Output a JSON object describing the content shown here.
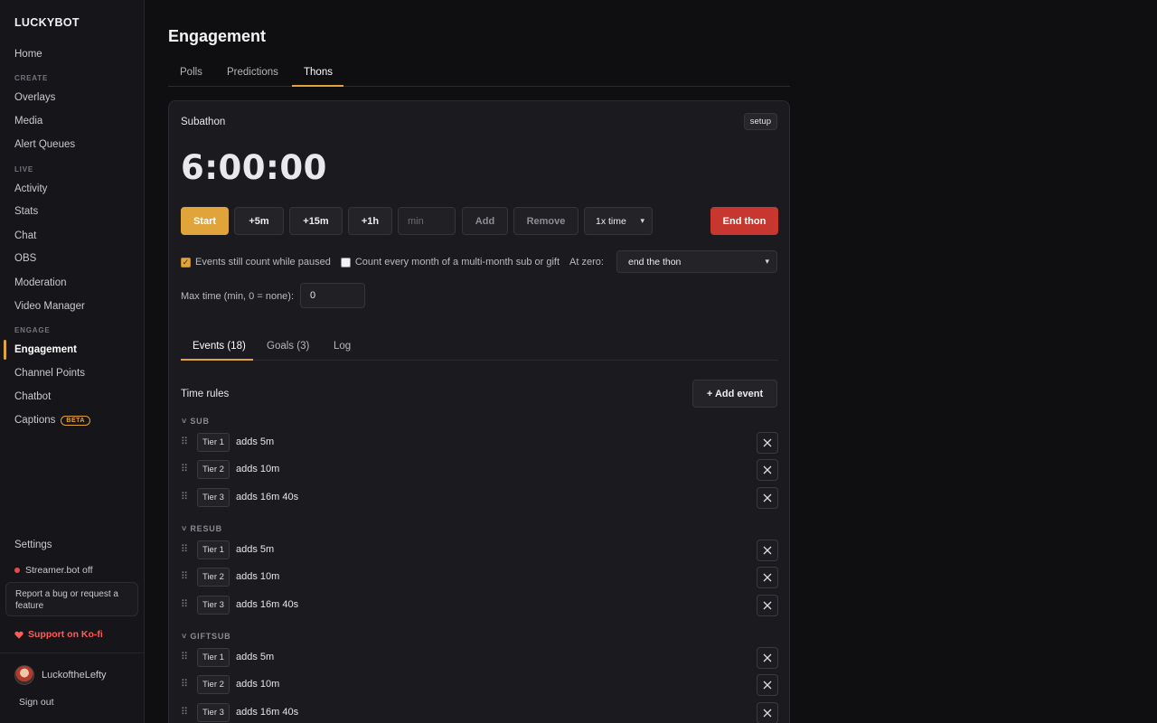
{
  "sidebar": {
    "brand": "LUCKYBOT",
    "home": "Home",
    "section_create": "CREATE",
    "overlays": "Overlays",
    "media": "Media",
    "alert_queues": "Alert Queues",
    "section_live": "LIVE",
    "activity": "Activity",
    "stats": "Stats",
    "chat": "Chat",
    "obs": "OBS",
    "moderation": "Moderation",
    "video_manager": "Video Manager",
    "section_engage": "ENGAGE",
    "engagement": "Engagement",
    "channel_points": "Channel Points",
    "chatbot": "Chatbot",
    "captions": "Captions",
    "beta_badge": "BETA",
    "settings": "Settings",
    "streamerbot_status": "Streamer.bot off",
    "bug_report": "Report a bug or request a feature",
    "kofi": "Support on Ko-fi",
    "username": "LuckoftheLefty",
    "sign_out": "Sign out",
    "status_color": "#e74b4b",
    "accent_color": "#e0a43a"
  },
  "main": {
    "title": "Engagement",
    "tabs": {
      "polls": "Polls",
      "predictions": "Predictions",
      "thons": "Thons"
    },
    "card": {
      "title": "Subathon",
      "setup": "setup",
      "timer": "6:00:00",
      "buttons": {
        "start": "Start",
        "plus5m": "+5m",
        "plus15m": "+15m",
        "plus1h": "+1h",
        "min_placeholder": "min",
        "add": "Add",
        "remove": "Remove",
        "speed": "1x time",
        "end": "End thon"
      },
      "options": {
        "paused_label": "Events still count while paused",
        "paused_checked": true,
        "multimonth_label": "Count every month of a multi-month sub or gift",
        "multimonth_checked": false,
        "at_zero_label": "At zero:",
        "at_zero_value": "end the thon",
        "max_time_label": "Max time (min, 0 = none):",
        "max_time_value": "0"
      },
      "subtabs": {
        "events": "Events (18)",
        "goals": "Goals (3)",
        "log": "Log"
      },
      "time_rules_label": "Time rules",
      "add_event": "+ Add event",
      "groups": [
        {
          "name": "SUB",
          "rules": [
            {
              "tier": "Tier 1",
              "text": "adds 5m"
            },
            {
              "tier": "Tier 2",
              "text": "adds 10m"
            },
            {
              "tier": "Tier 3",
              "text": "adds 16m 40s"
            }
          ]
        },
        {
          "name": "RESUB",
          "rules": [
            {
              "tier": "Tier 1",
              "text": "adds 5m"
            },
            {
              "tier": "Tier 2",
              "text": "adds 10m"
            },
            {
              "tier": "Tier 3",
              "text": "adds 16m 40s"
            }
          ]
        },
        {
          "name": "GIFTSUB",
          "rules": [
            {
              "tier": "Tier 1",
              "text": "adds 5m"
            },
            {
              "tier": "Tier 2",
              "text": "adds 10m"
            },
            {
              "tier": "Tier 3",
              "text": "adds 16m 40s"
            }
          ]
        }
      ]
    }
  }
}
